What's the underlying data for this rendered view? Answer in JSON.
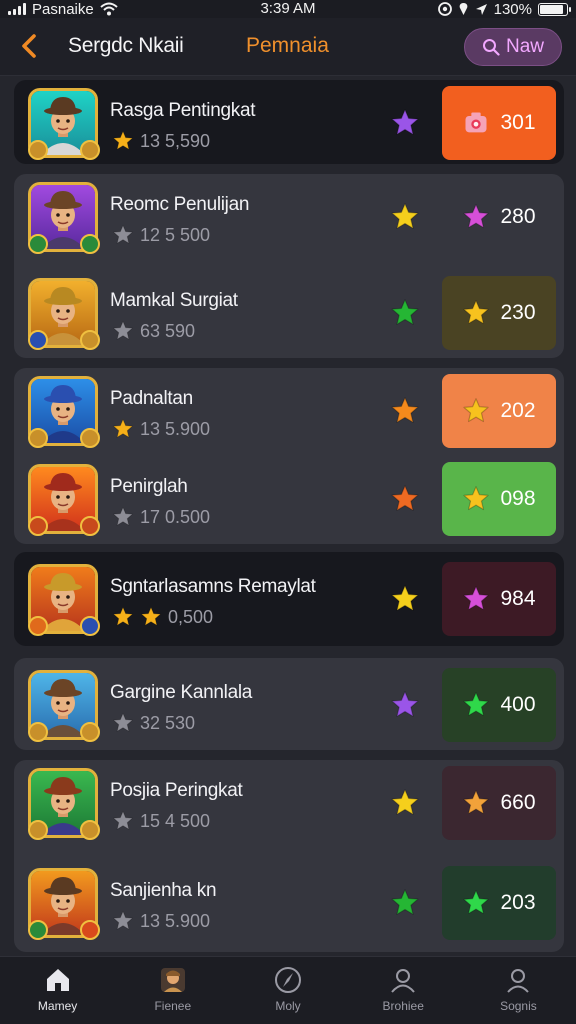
{
  "status_bar": {
    "carrier": "Pasnaike",
    "time": "3:39 AM",
    "battery": "130%",
    "battery_level": 0.9
  },
  "header": {
    "title": "Sergdc Nkaii",
    "tab_label": "Pemnaia",
    "new_button_label": "Naw"
  },
  "items": [
    {
      "name": "Rasga Pentingkat",
      "rating_text": "13  5,590",
      "score": "301",
      "score_icon": "camera-icon",
      "score_color": "#f25f1f",
      "mid_star_color": "#9a55e8",
      "row_stars": 1
    },
    {
      "name": "Reomc Penulijan",
      "rating_text": "12  5 500",
      "score": "280",
      "score_icon": "pink-star-icon",
      "score_color": "transparent",
      "mid_star_color": "#f5cf1c",
      "row_stars": 0
    },
    {
      "name": "Mamkal Surgiat",
      "rating_text": "63  590",
      "score": "230",
      "score_icon": "gold-star-icon",
      "score_color": "#4a4323",
      "mid_star_color": "#25b634",
      "row_stars": 0
    },
    {
      "name": "Padnaltan",
      "rating_text": "13  5.900",
      "score": "202",
      "score_icon": "gold-star-icon",
      "score_color": "#f08348",
      "mid_star_color": "#f58a1c",
      "row_stars": 1
    },
    {
      "name": "Penirglah",
      "rating_text": "17  0.500",
      "score": "098",
      "score_icon": "gold-star-icon",
      "score_color": "#59b54a",
      "mid_star_color": "#ef6a22",
      "row_stars": 0
    },
    {
      "name": "Sgntarlasamns Remaylat",
      "rating_text": "0,500",
      "score": "984",
      "score_icon": "pink-star-icon",
      "score_color": "#3d1a25",
      "mid_star_color": "#f5cf1c",
      "row_stars": 2
    },
    {
      "name": "Gargine Kannlala",
      "rating_text": "32  530",
      "score": "400",
      "score_icon": "green-star-icon",
      "score_color": "#274126",
      "mid_star_color": "#9a55e8",
      "row_stars": 0
    },
    {
      "name": "Posjia Peringkat",
      "rating_text": "15  4 500",
      "score": "660",
      "score_icon": "rainbow-star-icon",
      "score_color": "#3b2730",
      "mid_star_color": "#f5cf1c",
      "row_stars": 0
    },
    {
      "name": "Sanjienha kn",
      "rating_text": "13  5.900",
      "score": "203",
      "score_icon": "green-star-icon",
      "score_color": "#223d2c",
      "mid_star_color": "#25b634",
      "row_stars": 0
    }
  ],
  "nav": [
    {
      "label": "Mamey",
      "icon": "home-icon",
      "active": true
    },
    {
      "label": "Fienee",
      "icon": "character-icon",
      "active": false
    },
    {
      "label": "Moly",
      "icon": "compass-icon",
      "active": false
    },
    {
      "label": "Brohiee",
      "icon": "profile-icon",
      "active": false
    },
    {
      "label": "Sognis",
      "icon": "user-icon",
      "active": false
    }
  ]
}
